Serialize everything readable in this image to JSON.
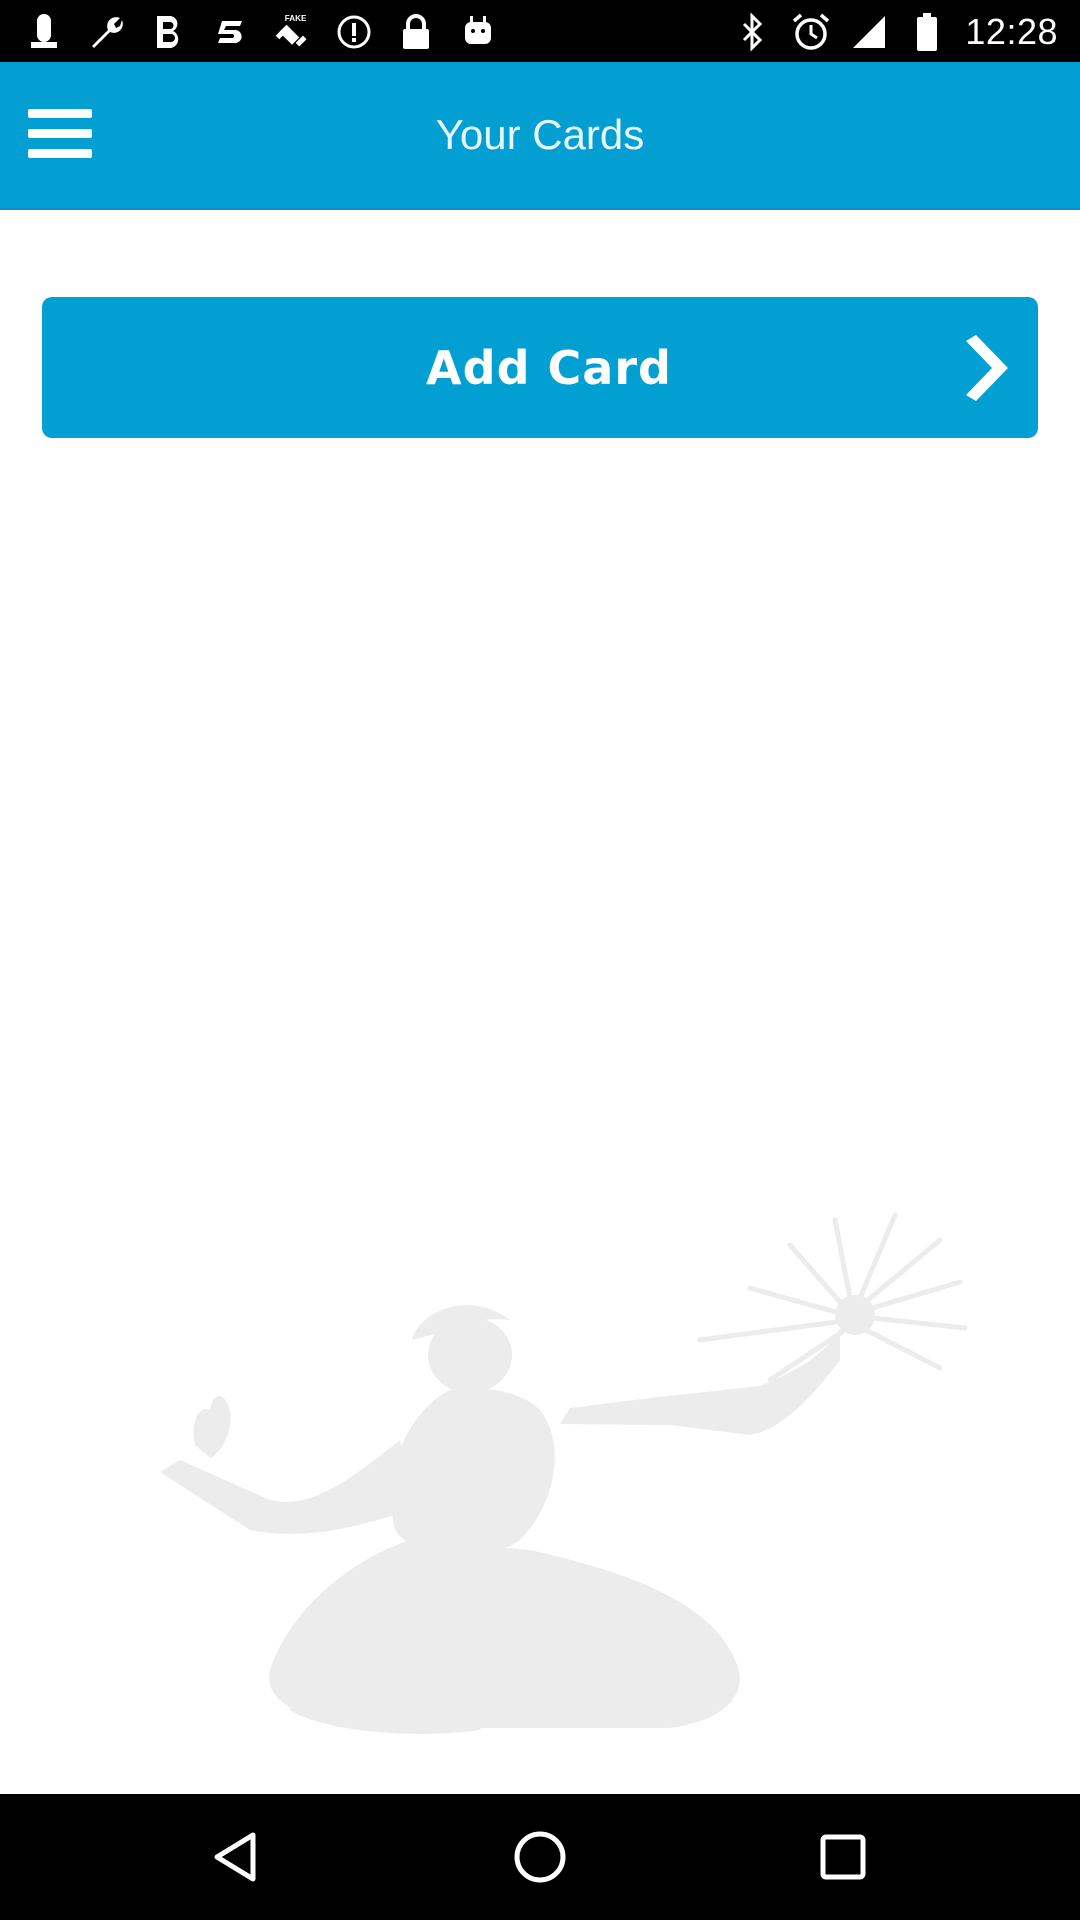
{
  "status_bar": {
    "time": "12:28",
    "left_icons": [
      "notification-icon",
      "wrench-icon",
      "bold-b-icon",
      "swap-icon",
      "fake-gps-icon",
      "info-icon",
      "lock-icon",
      "android-icon"
    ],
    "right_icons": [
      "bluetooth-icon",
      "alarm-icon",
      "signal-icon",
      "battery-icon"
    ]
  },
  "header": {
    "title": "Your Cards",
    "menu_icon": "hamburger-menu-icon"
  },
  "main": {
    "add_card_label": "Add Card",
    "add_card_icon": "chevron-right-icon"
  },
  "nav_bar": {
    "buttons": [
      "back-icon",
      "home-icon",
      "recents-icon"
    ]
  },
  "colors": {
    "primary": "#039fd2",
    "status_bar": "#000000",
    "background": "#ffffff",
    "watermark": "#ebebeb"
  }
}
